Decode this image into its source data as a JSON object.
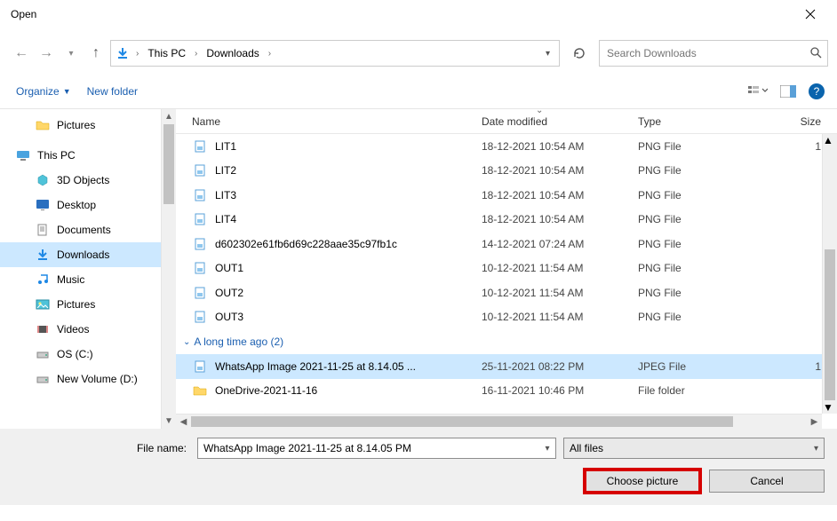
{
  "window": {
    "title": "Open"
  },
  "breadcrumb": {
    "root": "This PC",
    "folder": "Downloads"
  },
  "search": {
    "placeholder": "Search Downloads"
  },
  "toolbar": {
    "organize": "Organize",
    "new_folder": "New folder"
  },
  "tree": {
    "items": [
      {
        "label": "Pictures",
        "icon": "folder",
        "indent": 1
      },
      {
        "label": "",
        "icon": "",
        "indent": 0
      },
      {
        "label": "This PC",
        "icon": "pc",
        "indent": 0
      },
      {
        "label": "3D Objects",
        "icon": "3d",
        "indent": 1
      },
      {
        "label": "Desktop",
        "icon": "desktop",
        "indent": 1
      },
      {
        "label": "Documents",
        "icon": "documents",
        "indent": 1
      },
      {
        "label": "Downloads",
        "icon": "downloads",
        "indent": 1,
        "selected": true
      },
      {
        "label": "Music",
        "icon": "music",
        "indent": 1
      },
      {
        "label": "Pictures",
        "icon": "pictures",
        "indent": 1
      },
      {
        "label": "Videos",
        "icon": "videos",
        "indent": 1
      },
      {
        "label": "OS (C:)",
        "icon": "drive",
        "indent": 1
      },
      {
        "label": "New Volume (D:)",
        "icon": "drive",
        "indent": 1
      }
    ]
  },
  "columns": {
    "name": "Name",
    "date": "Date modified",
    "type": "Type",
    "size": "Size"
  },
  "files": [
    {
      "name": "LIT1",
      "date": "18-12-2021 10:54 AM",
      "type": "PNG File",
      "size": "1",
      "icon": "png"
    },
    {
      "name": "LIT2",
      "date": "18-12-2021 10:54 AM",
      "type": "PNG File",
      "size": "",
      "icon": "png"
    },
    {
      "name": "LIT3",
      "date": "18-12-2021 10:54 AM",
      "type": "PNG File",
      "size": "",
      "icon": "png"
    },
    {
      "name": "LIT4",
      "date": "18-12-2021 10:54 AM",
      "type": "PNG File",
      "size": "",
      "icon": "png"
    },
    {
      "name": "d602302e61fb6d69c228aae35c97fb1c",
      "date": "14-12-2021 07:24 AM",
      "type": "PNG File",
      "size": "",
      "icon": "png"
    },
    {
      "name": "OUT1",
      "date": "10-12-2021 11:54 AM",
      "type": "PNG File",
      "size": "",
      "icon": "png"
    },
    {
      "name": "OUT2",
      "date": "10-12-2021 11:54 AM",
      "type": "PNG File",
      "size": "",
      "icon": "png"
    },
    {
      "name": "OUT3",
      "date": "10-12-2021 11:54 AM",
      "type": "PNG File",
      "size": "",
      "icon": "png"
    }
  ],
  "group": {
    "label": "A long time ago (2)"
  },
  "files2": [
    {
      "name": "WhatsApp Image 2021-11-25 at 8.14.05 ...",
      "date": "25-11-2021 08:22 PM",
      "type": "JPEG File",
      "size": "1",
      "icon": "jpg",
      "selected": true
    },
    {
      "name": "OneDrive-2021-11-16",
      "date": "16-11-2021 10:46 PM",
      "type": "File folder",
      "size": "",
      "icon": "folder"
    }
  ],
  "footer": {
    "filename_label": "File name:",
    "filename_value": "WhatsApp Image 2021-11-25 at 8.14.05 PM",
    "filter": "All files",
    "choose": "Choose picture",
    "cancel": "Cancel"
  }
}
